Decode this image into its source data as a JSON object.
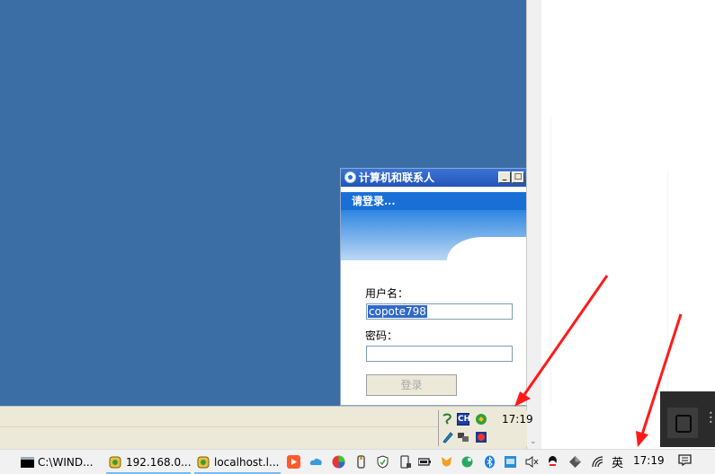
{
  "remote_window": {
    "title": "计算机和联系人",
    "header_text": "请登录...",
    "username_label": "用户名：",
    "username_value": "copote798",
    "password_label": "密码：",
    "password_value": "",
    "login_button": "登录",
    "tray_time": "17:19",
    "tray_icons": [
      "cn-icon",
      "ch-ime-icon",
      "refresh-icon",
      "pen-icon",
      "network-icon",
      "media-icon"
    ],
    "tray_ch_label": "CH"
  },
  "taskbar": {
    "items": [
      {
        "label": "C:\\WIND...",
        "icon": "cmd-icon"
      },
      {
        "label": "192.168.0....",
        "icon": "remote-desktop-icon"
      },
      {
        "label": "localhost.l...",
        "icon": "remote-desktop-icon"
      }
    ],
    "tray_icons": [
      "bilibili-icon",
      "cloud-icon",
      "color-wheel-icon",
      "usb-icon",
      "shield-icon",
      "phone-icon",
      "battery-icon",
      "fox-icon",
      "leaf-icon",
      "bluetooth-icon",
      "display-icon",
      "volume-muted-icon",
      "qq-icon",
      "diamond-icon",
      "wifi-icon"
    ],
    "ime": "英",
    "clock": "17:19",
    "notification_icon": "notification-icon"
  },
  "colors": {
    "desktop_blue": "#3a6ea5",
    "xp_title_blue": "#2355b8",
    "taskbar_bg": "#f1f1f1",
    "arrow_red": "#ff1a1a"
  }
}
